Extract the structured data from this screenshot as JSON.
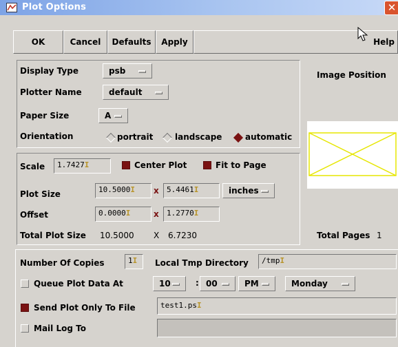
{
  "window": {
    "title": "Plot Options"
  },
  "toolbar": {
    "ok": "OK",
    "cancel": "Cancel",
    "defaults": "Defaults",
    "apply": "Apply",
    "help": "Help"
  },
  "display": {
    "display_type_label": "Display Type",
    "display_type_value": "psb",
    "plotter_name_label": "Plotter Name",
    "plotter_name_value": "default",
    "paper_size_label": "Paper Size",
    "paper_size_value": "A",
    "orientation_label": "Orientation",
    "orientation_options": [
      "portrait",
      "landscape",
      "automatic"
    ],
    "orientation_selected": "automatic"
  },
  "image_position": {
    "label": "Image Position"
  },
  "scale": {
    "label": "Scale",
    "value": "1.7427",
    "center_plot_label": "Center Plot",
    "center_plot_checked": true,
    "fit_to_page_label": "Fit to Page",
    "fit_to_page_checked": true,
    "plot_size_label": "Plot Size",
    "plot_width": "10.5000",
    "plot_height": "5.4461",
    "multiply_sign": "x",
    "units": "inches",
    "offset_label": "Offset",
    "offset_x": "0.0000",
    "offset_y": "1.2770",
    "total_plot_size_label": "Total Plot Size",
    "total_width": "10.5000",
    "total_height": "6.7230",
    "total_multiply_sign": "X",
    "total_pages_label": "Total Pages",
    "total_pages_value": "1"
  },
  "output": {
    "copies_label": "Number Of Copies",
    "copies_value": "1",
    "tmp_dir_label": "Local Tmp Directory",
    "tmp_dir_value": "/tmp",
    "queue_label": "Queue Plot Data At",
    "queue_checked": false,
    "queue_hour": "10",
    "time_sep": ":",
    "queue_minute": "00",
    "queue_ampm": "PM",
    "queue_day": "Monday",
    "send_file_label": "Send Plot Only To File",
    "send_file_checked": true,
    "send_file_value": "test1.ps",
    "mail_label": "Mail Log To",
    "mail_checked": false,
    "mail_value": ""
  },
  "colors": {
    "title_gradient_start": "#7da3e6",
    "close_button": "#d9542e",
    "checked": "#7a1212",
    "image_preview": "#e6e600"
  }
}
